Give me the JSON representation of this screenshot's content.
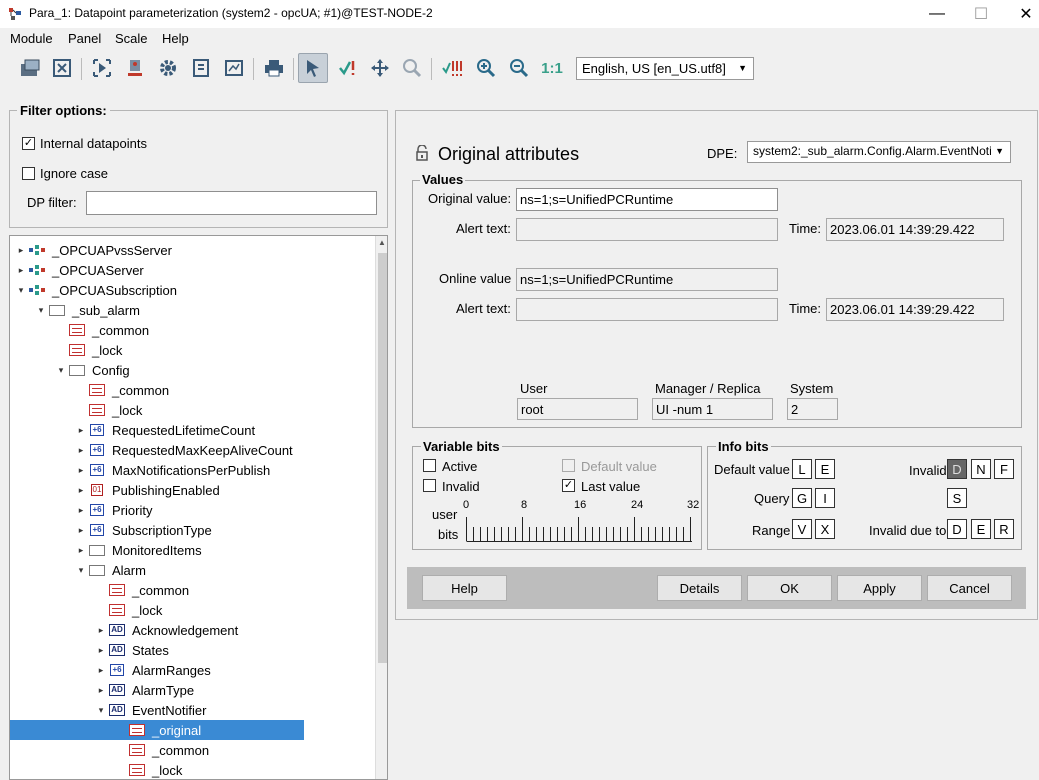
{
  "window": {
    "title": "Para_1: Datapoint parameterization (system2 - opcUA; #1)@TEST-NODE-2",
    "minimize": "—",
    "maximize": "☐",
    "close": "✕"
  },
  "menu": {
    "items": [
      "Module",
      "Panel",
      "Scale",
      "Help"
    ]
  },
  "toolbar": {
    "icons": [
      "open-module-icon",
      "close-module-icon",
      "run-icon",
      "panel-icon",
      "settings-icon",
      "export-icon",
      "chart-icon",
      "print-icon",
      "pointer-icon",
      "check-icon",
      "move-icon",
      "zoom-glass-icon",
      "alerts-icon",
      "zoom-in-icon",
      "zoom-out-icon"
    ],
    "zoom_reset": "1:1",
    "language": "English, US [en_US.utf8]"
  },
  "filter": {
    "title": "Filter options:",
    "internal_label": "Internal datapoints",
    "internal_checked": true,
    "ignore_case_label": "Ignore case",
    "ignore_case_checked": false,
    "dp_filter_label": "DP filter:",
    "dp_filter_value": ""
  },
  "tree": [
    {
      "label": "_OPCUAPvssServer",
      "icon": "sys",
      "level": 0,
      "twisty": "▸"
    },
    {
      "label": "_OPCUAServer",
      "icon": "sys",
      "level": 0,
      "twisty": "▸"
    },
    {
      "label": "_OPCUASubscription",
      "icon": "sys",
      "level": 0,
      "twisty": "▾"
    },
    {
      "label": "_sub_alarm",
      "icon": "folder",
      "level": 1,
      "twisty": "▾"
    },
    {
      "label": "_common",
      "icon": "struct",
      "level": 2,
      "twisty": ""
    },
    {
      "label": "_lock",
      "icon": "struct",
      "level": 2,
      "twisty": ""
    },
    {
      "label": "Config",
      "icon": "folder",
      "level": 2,
      "twisty": "▾"
    },
    {
      "label": "_common",
      "icon": "struct",
      "level": 3,
      "twisty": ""
    },
    {
      "label": "_lock",
      "icon": "struct",
      "level": 3,
      "twisty": ""
    },
    {
      "label": "RequestedLifetimeCount",
      "icon": "num",
      "level": 3,
      "twisty": "▸"
    },
    {
      "label": "RequestedMaxKeepAliveCount",
      "icon": "num",
      "level": 3,
      "twisty": "▸"
    },
    {
      "label": "MaxNotificationsPerPublish",
      "icon": "num",
      "level": 3,
      "twisty": "▸"
    },
    {
      "label": "PublishingEnabled",
      "icon": "bool",
      "level": 3,
      "twisty": "▸"
    },
    {
      "label": "Priority",
      "icon": "num",
      "level": 3,
      "twisty": "▸"
    },
    {
      "label": "SubscriptionType",
      "icon": "num",
      "level": 3,
      "twisty": "▸"
    },
    {
      "label": "MonitoredItems",
      "icon": "folder",
      "level": 3,
      "twisty": "▸"
    },
    {
      "label": "Alarm",
      "icon": "folder",
      "level": 3,
      "twisty": "▾"
    },
    {
      "label": "_common",
      "icon": "struct",
      "level": 4,
      "twisty": ""
    },
    {
      "label": "_lock",
      "icon": "struct",
      "level": 4,
      "twisty": ""
    },
    {
      "label": "Acknowledgement",
      "icon": "dp",
      "level": 4,
      "twisty": "▸"
    },
    {
      "label": "States",
      "icon": "dp",
      "level": 4,
      "twisty": "▸"
    },
    {
      "label": "AlarmRanges",
      "icon": "num",
      "level": 4,
      "twisty": "▸"
    },
    {
      "label": "AlarmType",
      "icon": "dp",
      "level": 4,
      "twisty": "▸"
    },
    {
      "label": "EventNotifier",
      "icon": "dp",
      "level": 4,
      "twisty": "▾"
    },
    {
      "label": "_original",
      "icon": "struct",
      "level": 5,
      "twisty": "",
      "selected": true
    },
    {
      "label": "_common",
      "icon": "struct",
      "level": 5,
      "twisty": ""
    },
    {
      "label": "_lock",
      "icon": "struct",
      "level": 5,
      "twisty": ""
    }
  ],
  "icon_text": {
    "num": "+6",
    "bool": "01",
    "dp": "AD"
  },
  "attrs": {
    "title": "Original attributes",
    "dpe_label": "DPE:",
    "dpe_value": "system2:_sub_alarm.Config.Alarm.EventNoti",
    "values_title": "Values",
    "original_value_label": "Original value:",
    "original_value": "ns=1;s=UnifiedPCRuntime",
    "alert_text_label": "Alert text:",
    "alert_text_1": "",
    "time_label": "Time:",
    "time_1": "2023.06.01 14:39:29.422",
    "online_value_label": "Online value",
    "online_value": "ns=1;s=UnifiedPCRuntime",
    "alert_text_2": "",
    "time_2": "2023.06.01 14:39:29.422",
    "user_label": "User",
    "user_value": "root",
    "manager_label": "Manager / Replica",
    "manager_value": "UI -num 1",
    "system_label": "System",
    "system_value": "2"
  },
  "variable_bits": {
    "title": "Variable bits",
    "active_label": "Active",
    "active_checked": false,
    "default_value_label": "Default value",
    "default_value_checked": false,
    "invalid_label": "Invalid",
    "invalid_checked": false,
    "last_value_label": "Last value",
    "last_value_checked": true,
    "user_label": "user",
    "bits_label": "bits",
    "scale": [
      "0",
      "8",
      "16",
      "24",
      "32"
    ]
  },
  "info_bits": {
    "title": "Info bits",
    "default_value_label": "Default value",
    "default_value_bits": [
      "L",
      "E"
    ],
    "query_label": "Query",
    "query_bits": [
      "G",
      "I"
    ],
    "range_label": "Range",
    "range_bits": [
      "V",
      "X"
    ],
    "invalid_label": "Invalid",
    "invalid_bits": [
      "D",
      "N",
      "F"
    ],
    "s_bit": "S",
    "invalid_due_to_label": "Invalid due to",
    "invalid_due_to_bits": [
      "D",
      "E",
      "R"
    ]
  },
  "buttons": {
    "help": "Help",
    "details": "Details",
    "ok": "OK",
    "apply": "Apply",
    "cancel": "Cancel"
  }
}
